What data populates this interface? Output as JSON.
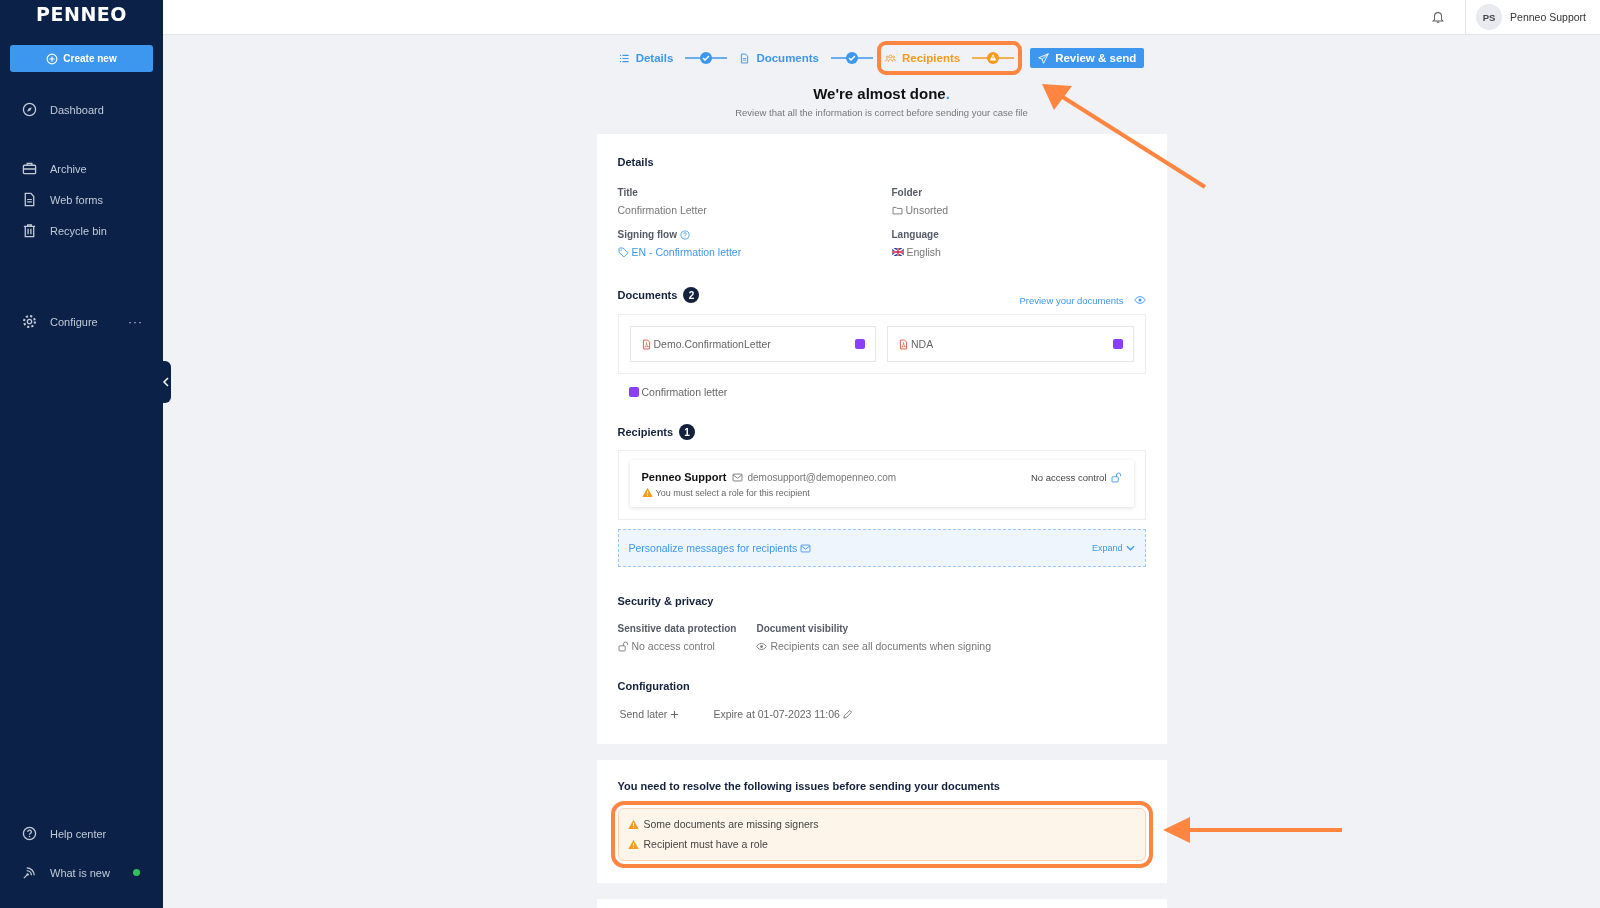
{
  "sidebar": {
    "logo": "PENNEO",
    "create_button": "Create new",
    "items": [
      {
        "kind": "compass",
        "label": "Dashboard"
      },
      {
        "kind": "briefcase",
        "label": "Archive"
      },
      {
        "kind": "form",
        "label": "Web forms"
      },
      {
        "kind": "trash",
        "label": "Recycle bin"
      },
      {
        "kind": "gear",
        "label": "Configure",
        "more": "···"
      }
    ],
    "bottom_items": [
      {
        "kind": "help",
        "label": "Help center",
        "new_dot": false
      },
      {
        "kind": "signal",
        "label": "What is new",
        "new_dot": true
      }
    ]
  },
  "top_bar": {
    "user": {
      "initials": "PS",
      "name": "Penneo Support"
    }
  },
  "steps": [
    {
      "kind": "list",
      "label": "Details",
      "warning": false,
      "highlighted": false
    },
    {
      "kind": "document",
      "label": "Documents",
      "warning": false,
      "highlighted": false
    },
    {
      "kind": "people",
      "label": "Recipients",
      "warning": true,
      "highlighted": true
    }
  ],
  "send_button": "Review & send",
  "heading": {
    "title": "We're almost done",
    "title_mark": ".",
    "subtitle": "Review that all the information is correct before sending your case file"
  },
  "details": {
    "title": "Details",
    "fields": [
      {
        "label": "Title",
        "value": "Confirmation Letter",
        "kind": "text"
      },
      {
        "label": "Folder",
        "value": "Unsorted",
        "kind": "folder"
      },
      {
        "label": "Signing flow",
        "value": "EN - Confirmation letter",
        "kind": "tag"
      },
      {
        "label": "Language",
        "value": "English",
        "kind": "flag"
      }
    ]
  },
  "documents": {
    "title": "Documents",
    "count": "2",
    "preview_link": "Preview your documents",
    "files": [
      {
        "name": "Demo.ConfirmationLetter",
        "color": "#8a3ffc"
      },
      {
        "name": "NDA",
        "color": "#8a3ffc"
      }
    ],
    "types": [
      {
        "label": "Confirmation letter",
        "color": "#8a3ffc"
      }
    ]
  },
  "recipients": {
    "title": "Recipients",
    "count": "1",
    "items": [
      {
        "name": "Penneo Support",
        "email": "demosupport@demopenneo.com",
        "warning": "You must select a role for this recipient",
        "access": "No access control"
      }
    ],
    "personalize": "Personalize messages for recipients",
    "expand": "Expand"
  },
  "security": {
    "title": "Security & privacy",
    "fields": [
      {
        "label": "Sensitive data protection",
        "value": "No access control",
        "kind": "lock"
      },
      {
        "label": "Document visibility",
        "value": "Recipients can see all documents when signing",
        "kind": "eye"
      }
    ]
  },
  "configuration": {
    "title": "Configuration",
    "send_later": "Send later",
    "expire": "Expire at 01-07-2023 11:06"
  },
  "issues": {
    "title": "You need to resolve the following issues before sending your documents",
    "highlighted": true,
    "items": [
      "Some documents are missing signers",
      "Recipient must have a role"
    ]
  }
}
